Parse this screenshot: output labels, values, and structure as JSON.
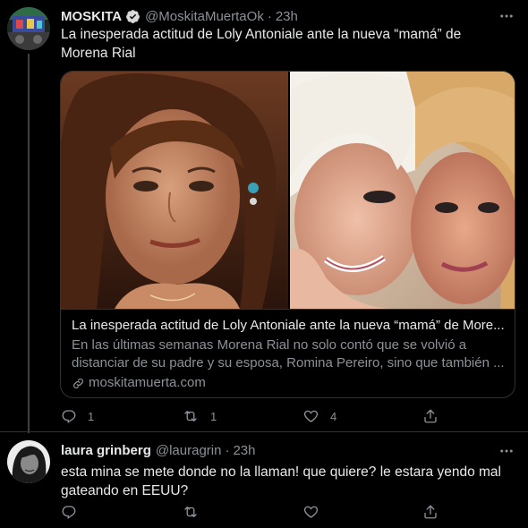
{
  "tweet1": {
    "name": "MOSKITA",
    "handle": "@MoskitaMuertaOk",
    "separator": "·",
    "time": "23h",
    "text": "La inesperada actitud de Loly Antoniale ante la  nueva “mamá” de Morena Rial",
    "card": {
      "title": "La inesperada actitud de Loly Antoniale ante la nueva “mamá” de More...",
      "description": "En las últimas semanas Morena Rial no solo contó que se volvió a distanciar de su padre y su esposa, Romina Pereiro, sino que también ...",
      "domain": "moskitamuerta.com"
    },
    "actions": {
      "replies": "1",
      "retweets": "1",
      "likes": "4"
    }
  },
  "tweet2": {
    "name": "laura grinberg",
    "handle": "@lauragrin",
    "separator": "·",
    "time": "23h",
    "text": "esta mina se mete donde no la llaman! que quiere? le estara yendo mal gateando en EEUU?"
  },
  "colors": {
    "background": "#000000",
    "text": "#e7e9ea",
    "secondary": "#8b9198",
    "verified": "#d9d9d9",
    "border": "#2f3336"
  },
  "icons": [
    "verified-badge-icon",
    "more-icon",
    "reply-icon",
    "retweet-icon",
    "like-icon",
    "share-icon",
    "link-icon"
  ]
}
